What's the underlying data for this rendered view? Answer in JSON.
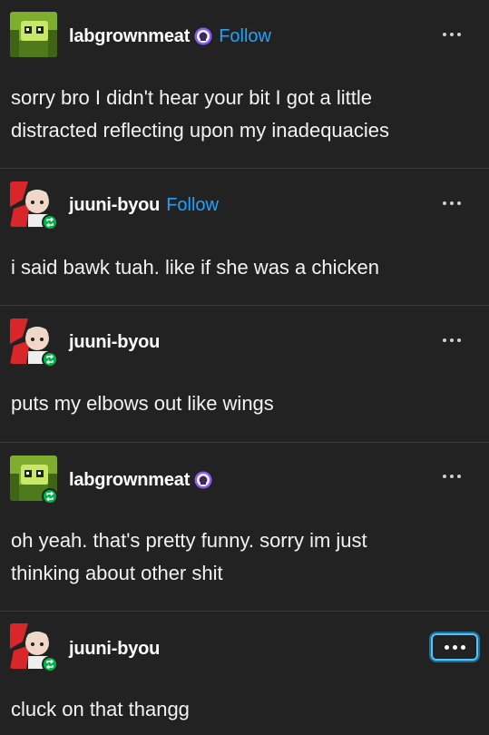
{
  "posts": [
    {
      "username": "labgrownmeat",
      "follow_label": "Follow",
      "has_badge": true,
      "reblog": false,
      "text_lines": [
        "sorry bro I didn't hear your bit I got a little",
        "distracted reflecting upon my inadequacies"
      ]
    },
    {
      "username": "juuni-byou",
      "follow_label": "Follow",
      "has_badge": false,
      "reblog": true,
      "text_lines": [
        "i said bawk tuah. like if she was a chicken"
      ]
    },
    {
      "username": "juuni-byou",
      "has_badge": false,
      "reblog": true,
      "text_lines": [
        "puts my elbows out like wings"
      ]
    },
    {
      "username": "labgrownmeat",
      "has_badge": true,
      "reblog": true,
      "text_lines": [
        "oh yeah. that's pretty funny. sorry im just",
        "thinking about other shit"
      ]
    },
    {
      "username": "juuni-byou",
      "has_badge": false,
      "reblog": true,
      "text_lines": [
        "cluck on that thangg"
      ]
    }
  ],
  "colors": {
    "background": "#222222",
    "follow": "#1ea2ff",
    "reblog_badge": "#00b34a",
    "focus_ring": "#4fc6ff"
  },
  "icons": {
    "more": "more-options-icon",
    "reblog": "reblog-icon",
    "badge": "brain-badge-icon"
  }
}
